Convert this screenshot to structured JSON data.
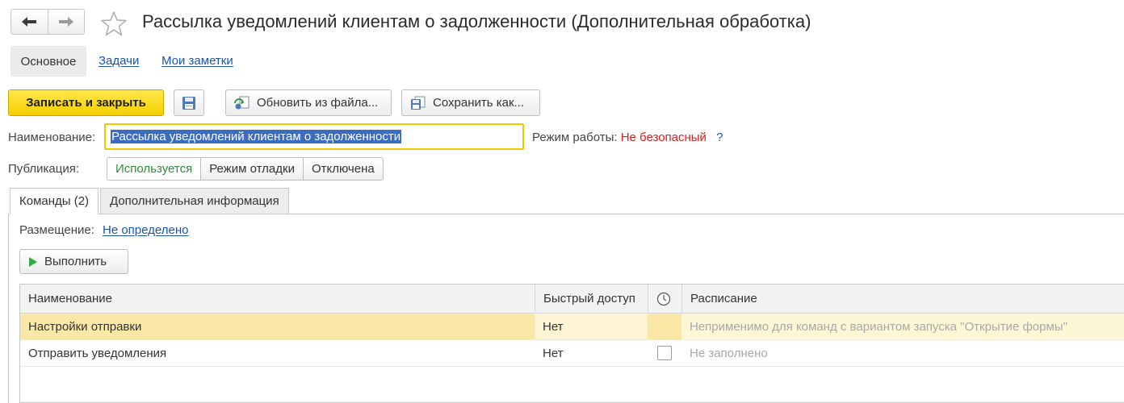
{
  "window": {
    "title": "Рассылка уведомлений клиентам о задолженности (Дополнительная обработка)"
  },
  "top_tabs": {
    "active": "Основное",
    "links": [
      "Задачи",
      "Мои заметки"
    ]
  },
  "toolbar": {
    "save_close": "Записать и закрыть",
    "update_from_file": "Обновить из файла...",
    "save_as": "Сохранить как..."
  },
  "form": {
    "name_label": "Наименование:",
    "name_value": "Рассылка уведомлений клиентам о задолженности",
    "mode_label": "Режим работы:",
    "mode_value": "Не безопасный",
    "help": "?",
    "publication_label": "Публикация:",
    "publication_options": [
      "Используется",
      "Режим отладки",
      "Отключена"
    ],
    "publication_selected": "Используется"
  },
  "tabs": [
    {
      "label": "Команды (2)",
      "active": true
    },
    {
      "label": "Дополнительная информация",
      "active": false
    }
  ],
  "commands": {
    "placement_label": "Размещение:",
    "placement_value": "Не определено",
    "run_button": "Выполнить",
    "columns": [
      "Наименование",
      "Быстрый доступ",
      "Расписание"
    ],
    "rows": [
      {
        "name": "Настройки отправки",
        "quick_access": "Нет",
        "scheduled": null,
        "schedule": "Неприменимо для команд с вариантом запуска \"Открытие формы\"",
        "selected": true
      },
      {
        "name": "Отправить уведомления",
        "quick_access": "Нет",
        "scheduled": false,
        "schedule": "Не заполнено",
        "selected": false
      }
    ]
  },
  "icons": {
    "back": "arrow-left-icon",
    "forward": "arrow-right-icon",
    "favorite": "star-icon",
    "save": "floppy-disk-icon",
    "update": "update-from-file-icon",
    "save_as": "save-as-icon",
    "run": "play-icon",
    "clock": "clock-icon"
  },
  "colors": {
    "primary_button": "#f5cf00",
    "link": "#1a56a8",
    "danger": "#d41f1f",
    "active_option": "#2e8b3a",
    "selected_row": "#fbe8a6"
  }
}
